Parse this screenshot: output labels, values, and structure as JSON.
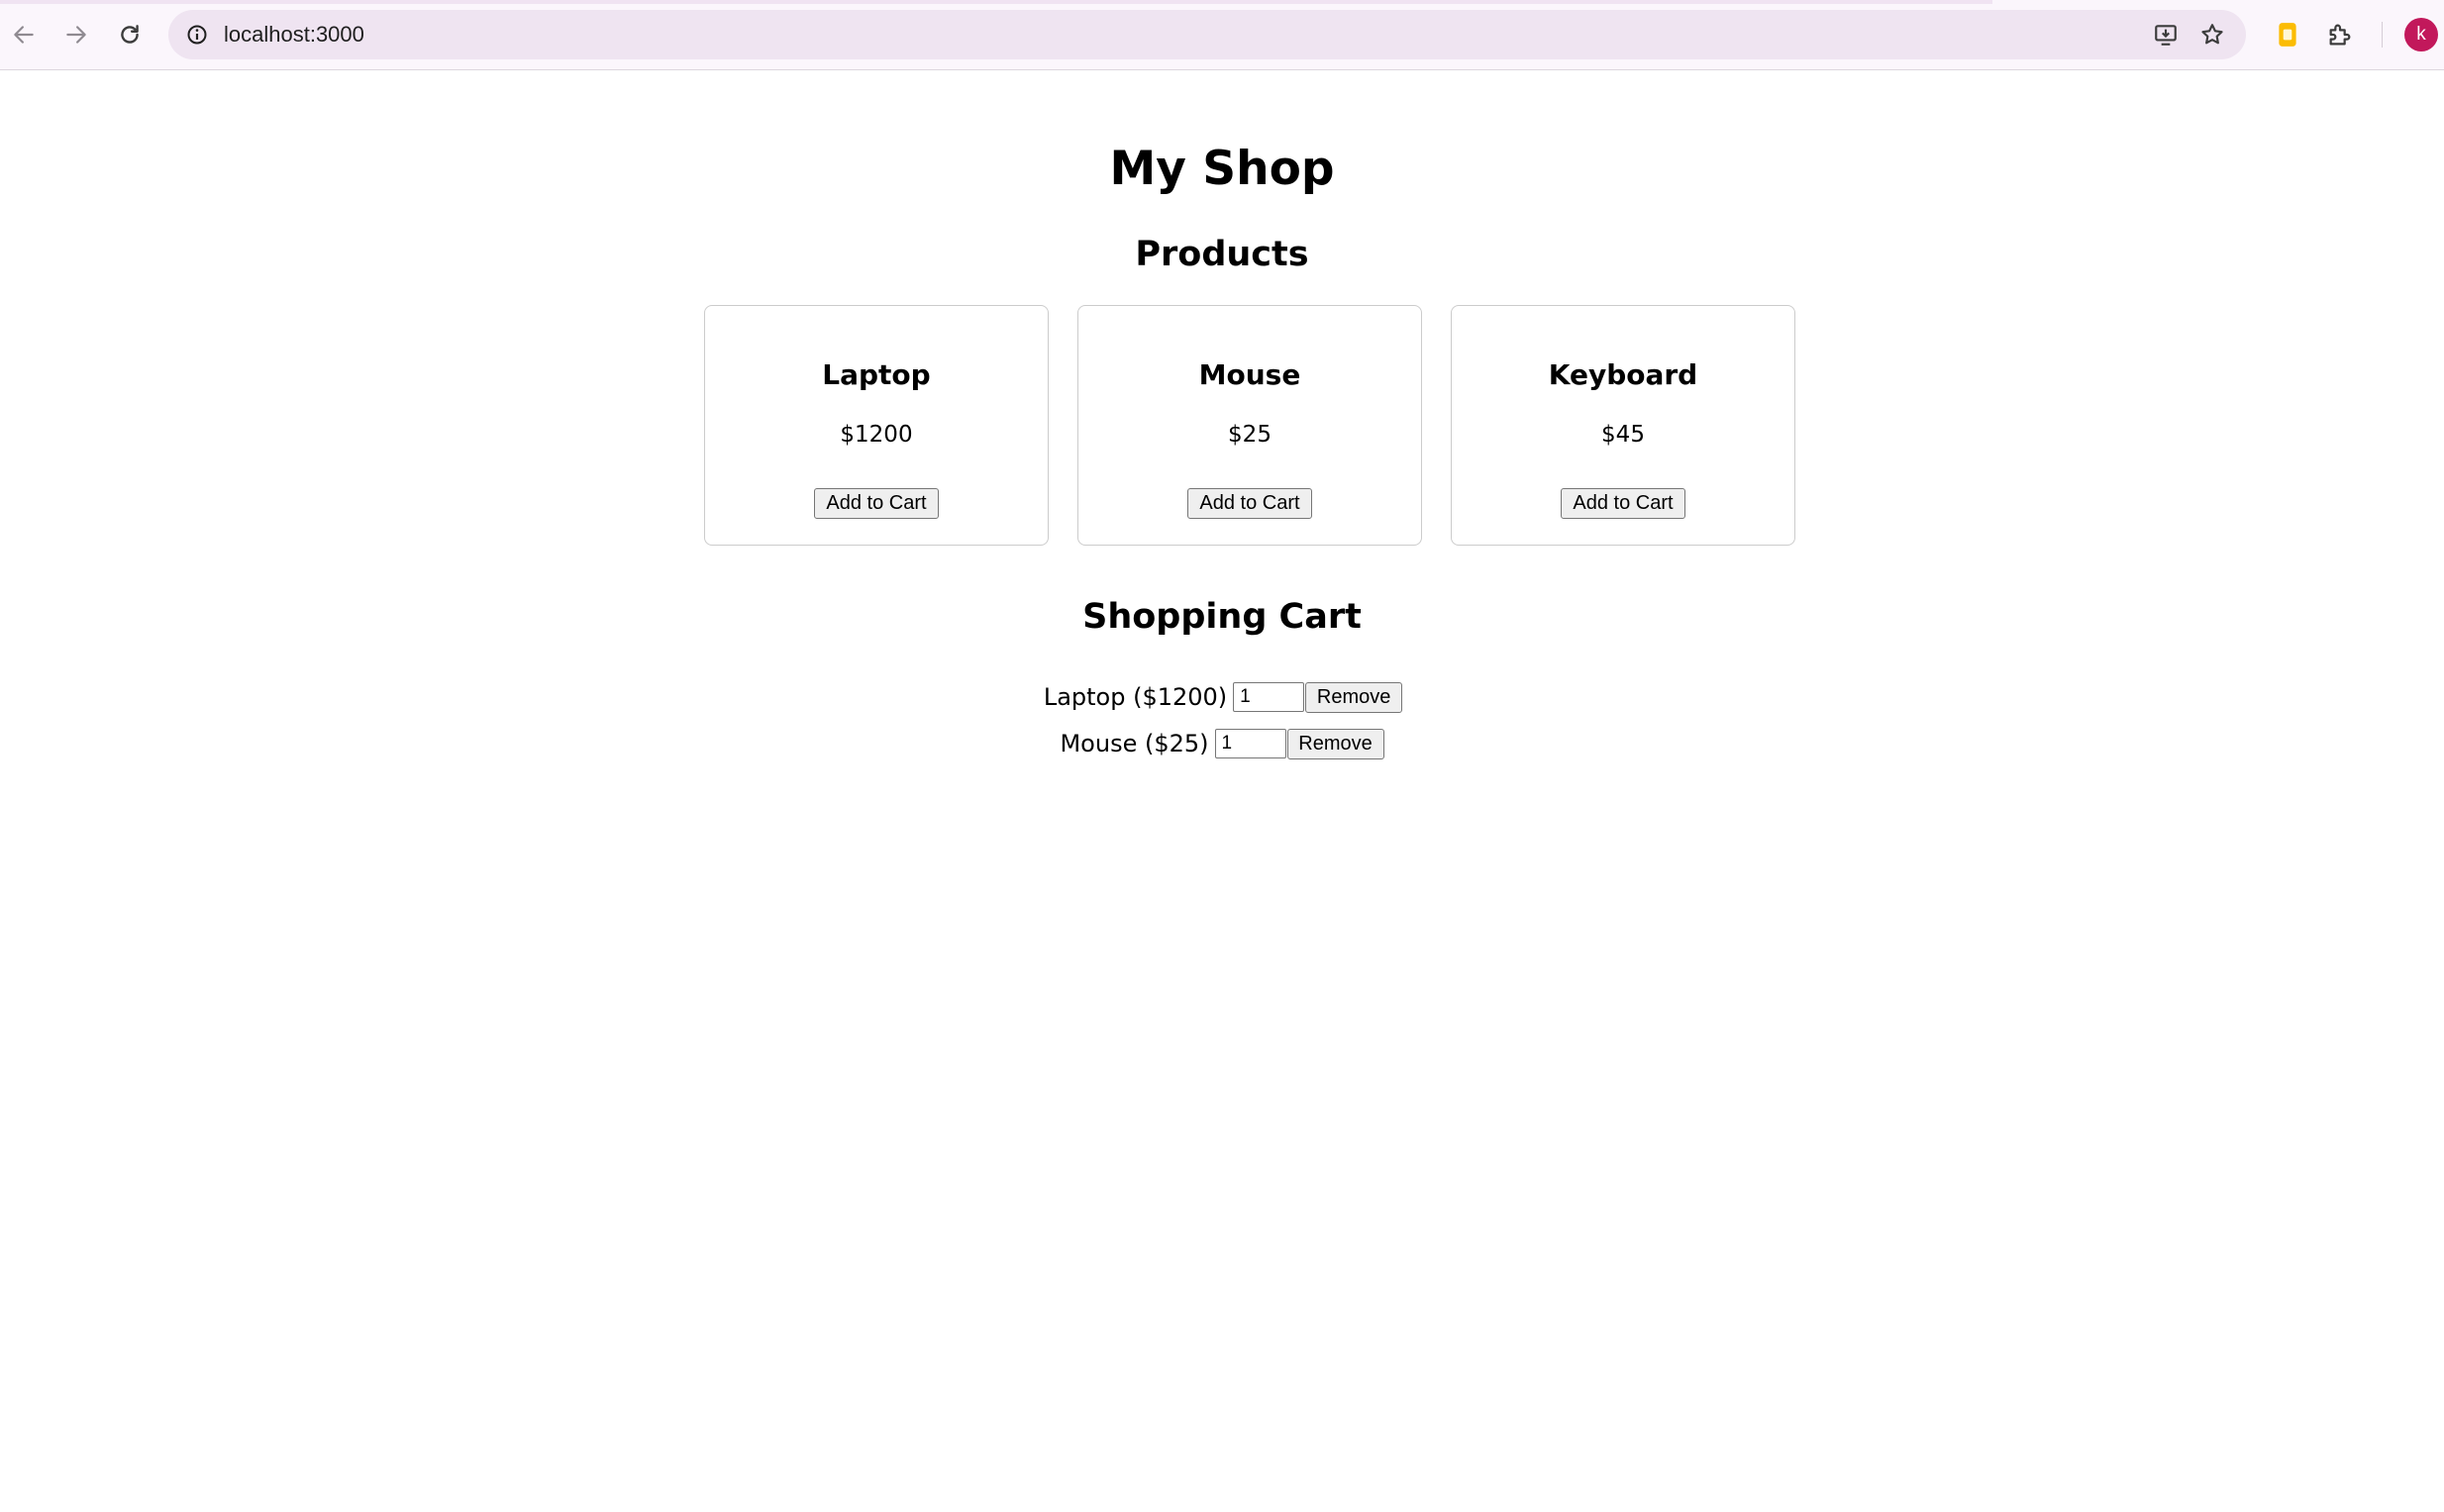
{
  "browser": {
    "url": "localhost:3000",
    "avatar_letter": "k",
    "accent_color": "#c2185b",
    "icons": [
      "back-arrow-icon",
      "forward-arrow-icon",
      "reload-icon",
      "site-info-icon",
      "install-app-icon",
      "bookmark-star-icon",
      "extension-puzzle-icon",
      "profile-avatar"
    ]
  },
  "page": {
    "title": "My Shop",
    "products_heading": "Products",
    "cart_heading": "Shopping Cart"
  },
  "products": [
    {
      "name": "Laptop",
      "price": "$1200",
      "button": "Add to Cart"
    },
    {
      "name": "Mouse",
      "price": "$25",
      "button": "Add to Cart"
    },
    {
      "name": "Keyboard",
      "price": "$45",
      "button": "Add to Cart"
    }
  ],
  "cart": [
    {
      "label": "Laptop ($1200)",
      "quantity": "1",
      "button": "Remove"
    },
    {
      "label": "Mouse ($25)",
      "quantity": "1",
      "button": "Remove"
    }
  ]
}
